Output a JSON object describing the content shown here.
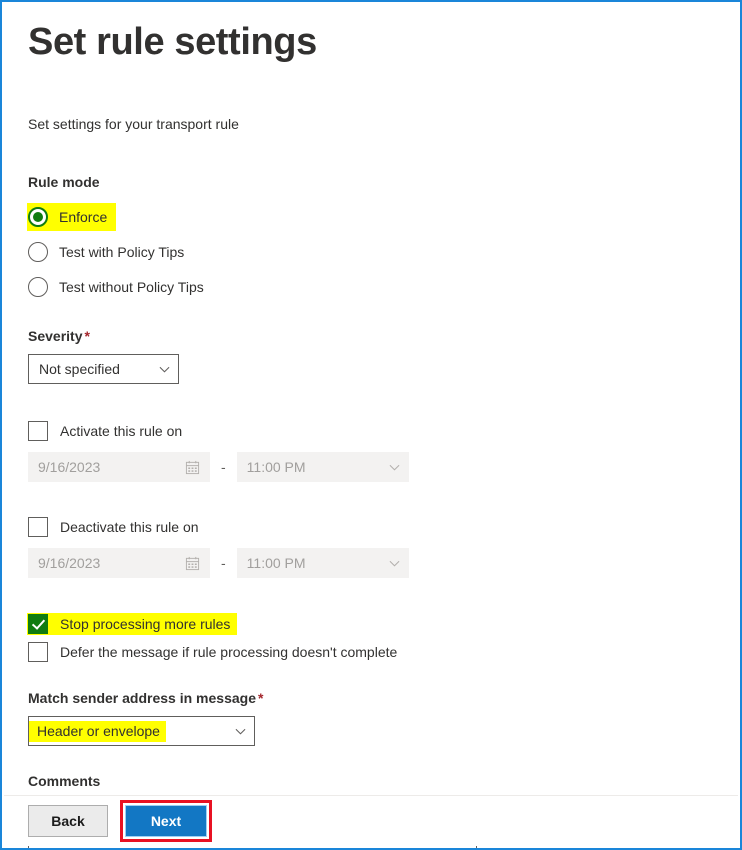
{
  "page": {
    "title": "Set rule settings",
    "subtitle": "Set settings for your transport rule"
  },
  "rule_mode": {
    "label": "Rule mode",
    "options": [
      {
        "label": "Enforce",
        "selected": true,
        "highlighted": true
      },
      {
        "label": "Test with Policy Tips",
        "selected": false,
        "highlighted": false
      },
      {
        "label": "Test without Policy Tips",
        "selected": false,
        "highlighted": false
      }
    ]
  },
  "severity": {
    "label": "Severity",
    "required_marker": "*",
    "value": "Not specified"
  },
  "activate": {
    "checkbox_label": "Activate this rule on",
    "checked": false,
    "date": "9/16/2023",
    "separator": "-",
    "time": "11:00 PM"
  },
  "deactivate": {
    "checkbox_label": "Deactivate this rule on",
    "checked": false,
    "date": "9/16/2023",
    "separator": "-",
    "time": "11:00 PM"
  },
  "stop_processing": {
    "label": "Stop processing more rules",
    "checked": true,
    "highlighted": true
  },
  "defer_message": {
    "label": "Defer the message if rule processing doesn't complete",
    "checked": false,
    "highlighted": false
  },
  "match_sender": {
    "label": "Match sender address in message",
    "required_marker": "*",
    "value": "Header or envelope",
    "highlighted": true
  },
  "comments": {
    "label": "Comments",
    "value": "",
    "placeholder": ""
  },
  "footer": {
    "back_label": "Back",
    "next_label": "Next"
  },
  "colors": {
    "window_border": "#1a86d9",
    "highlight": "#ffff00",
    "green": "#107c10",
    "required": "#a4262c",
    "primary_button": "#1277c4",
    "annotation": "#e81123",
    "disabled_field": "#f3f2f1"
  }
}
